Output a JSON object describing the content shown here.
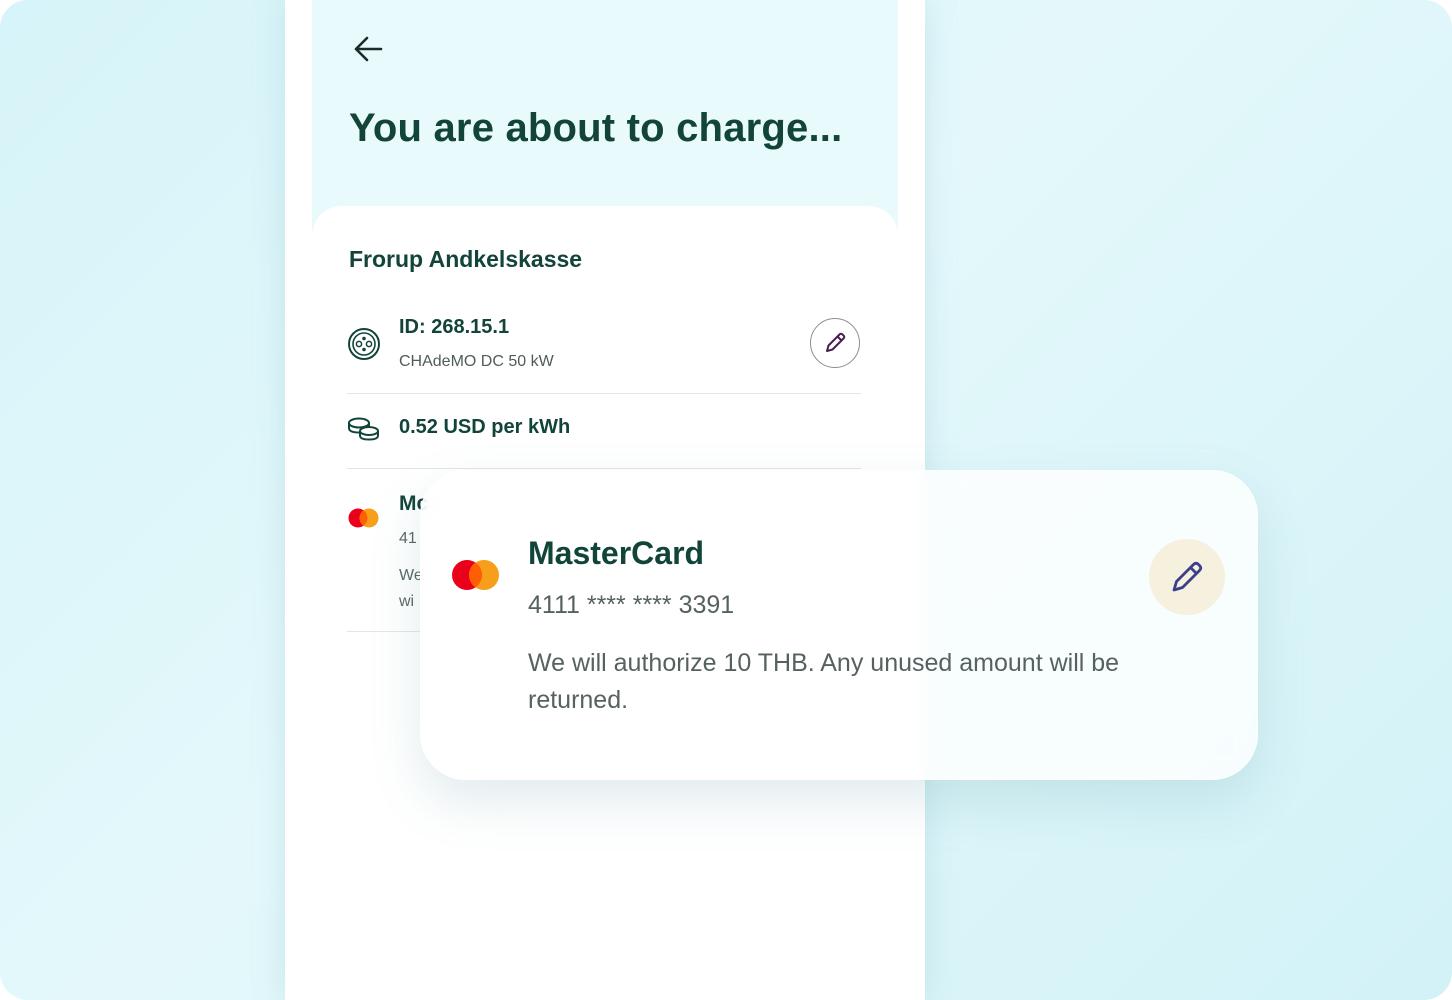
{
  "header": {
    "back_icon": "arrow-left-icon",
    "title": "You are about to charge..."
  },
  "station": {
    "name": "Frorup Andkelskasse",
    "connector_icon": "chademo-connector-icon",
    "id_label": "ID: 268.15.1",
    "connector": "CHAdeMO DC 50 kW",
    "edit_icon": "pencil-icon"
  },
  "pricing": {
    "icon": "coins-icon",
    "price": "0.52 USD per kWh"
  },
  "payment_underlay": {
    "title_fragment": "Mc",
    "number_fragment": "41",
    "note_line1_fragment": "We",
    "note_line2_fragment": "wi"
  },
  "payment_card": {
    "logo_icon": "mastercard-logo-icon",
    "title": "MasterCard",
    "number": "4111 **** **** 3391",
    "note": "We will authorize 10 THB. Any unused amount will be returned.",
    "edit_icon": "pencil-icon"
  },
  "colors": {
    "primary_text": "#12443a",
    "background": "#d6f4f9",
    "edit_bg": "#f6f0df",
    "pencil": "#3b3f8c",
    "pencil_small": "#4a1d4f",
    "mc_red": "#eb001b",
    "mc_orange": "#f79e1b"
  }
}
